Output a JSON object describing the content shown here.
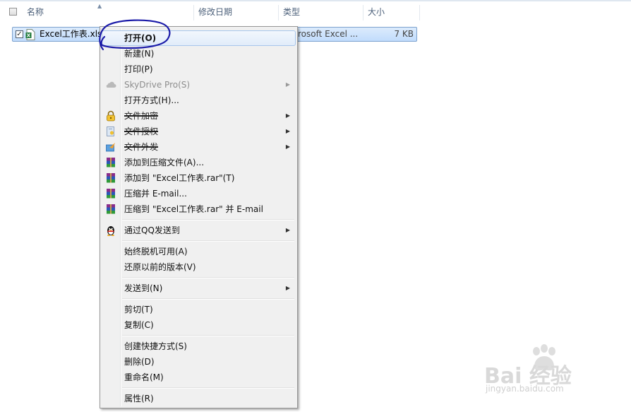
{
  "header": {
    "col_name": "名称",
    "col_date": "修改日期",
    "col_type": "类型",
    "col_size": "大小"
  },
  "file": {
    "name": "Excel工作表.xlsx",
    "type": "rosoft Excel ...",
    "size": "7 KB",
    "checked": true
  },
  "menu": {
    "open": "打开(O)",
    "new": "新建(N)",
    "print": "打印(P)",
    "skydrive": "SkyDrive Pro(S)",
    "open_with": "打开方式(H)...",
    "encrypt": "文件加密",
    "authorize": "文件授权",
    "outsource": "文件外发",
    "add_archive": "添加到压缩文件(A)...",
    "add_rar": "添加到 \"Excel工作表.rar\"(T)",
    "compress_email": "压缩并 E-mail...",
    "compress_rar_email": "压缩到 \"Excel工作表.rar\" 并 E-mail",
    "send_qq": "通过QQ发送到",
    "always_offline": "始终脱机可用(A)",
    "restore_versions": "还原以前的版本(V)",
    "send_to": "发送到(N)",
    "cut": "剪切(T)",
    "copy": "复制(C)",
    "create_shortcut": "创建快捷方式(S)",
    "delete": "删除(D)",
    "rename": "重命名(M)",
    "properties": "属性(R)"
  },
  "icons": {
    "file": "excel-file-icon",
    "cloud": "skydrive-cloud-icon",
    "lock": "lock-icon",
    "authorize": "document-key-icon",
    "outsource": "send-document-icon",
    "winrar": "winrar-icon",
    "qq": "qq-penguin-icon",
    "submenu": "chevron-right-icon"
  },
  "watermark": {
    "main": "Bai 经验",
    "sub": "jingyan.baidu.com"
  },
  "colors": {
    "selection": "#c1dcfc",
    "menu_bg": "#f0f0f0",
    "annotation": "#1a1aa8"
  }
}
